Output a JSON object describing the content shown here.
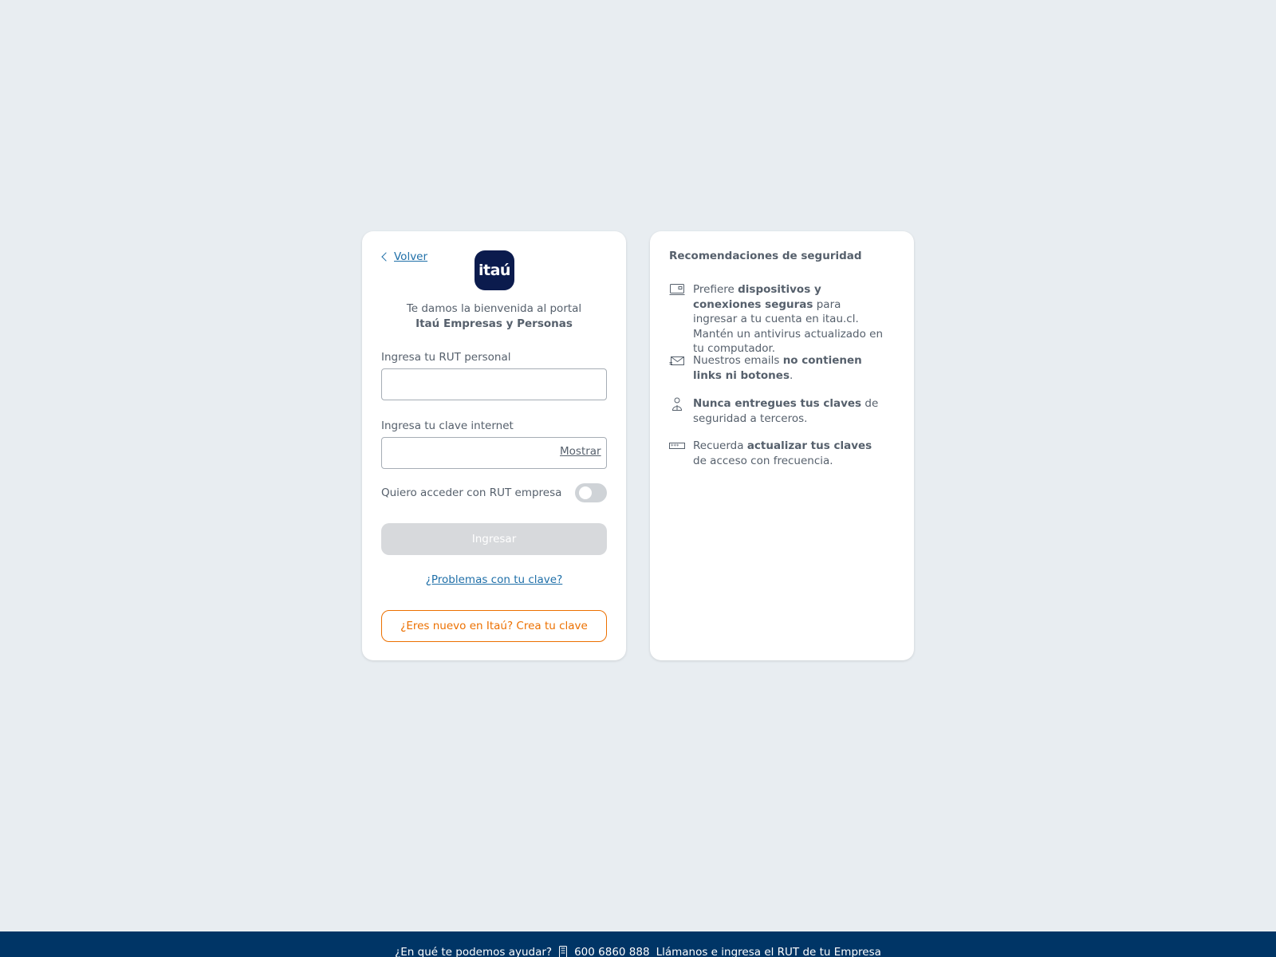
{
  "login": {
    "back_label": "Volver",
    "logo_text": "itaú",
    "welcome_line1": "Te damos la bienvenida al portal",
    "welcome_line2": "Itaú Empresas y Personas",
    "rut_label": "Ingresa tu RUT personal",
    "rut_value": "",
    "password_label": "Ingresa tu clave internet",
    "password_value": "",
    "show_label": "Mostrar",
    "company_toggle_label": "Quiero acceder con RUT empresa",
    "company_toggle_on": false,
    "submit_label": "Ingresar",
    "problems_label": "¿Problemas con tu clave?",
    "create_label": "¿Eres nuevo en Itaú? Crea tu clave"
  },
  "security": {
    "title": "Recomendaciones de seguridad",
    "tips": [
      {
        "icon": "laptop-icon",
        "pre": "Prefiere ",
        "bold": "dispositivos y conexiones seguras",
        "post": " para ingresar a tu cuenta en itau.cl. Mantén un antivirus actualizado en tu computador."
      },
      {
        "icon": "envelope-icon",
        "pre": "Nuestros emails ",
        "bold": "no contienen links ni botones",
        "post": "."
      },
      {
        "icon": "person-icon",
        "pre": "",
        "bold": "Nunca entregues tus claves",
        "post": " de seguridad a terceros."
      },
      {
        "icon": "password-icon",
        "pre": "Recuerda ",
        "bold": "actualizar tus claves",
        "post": " de acceso con frecuencia."
      }
    ]
  },
  "footer": {
    "help_text": "¿En qué te podemos ayudar?",
    "phone": "600 6860 888",
    "instruction": "Llámanos e ingresa el RUT de tu Empresa"
  },
  "colors": {
    "brand_navy": "#0b1b4d",
    "accent_orange": "#ec7000",
    "link_blue": "#1f6fa8",
    "footer_bg": "#003566"
  }
}
